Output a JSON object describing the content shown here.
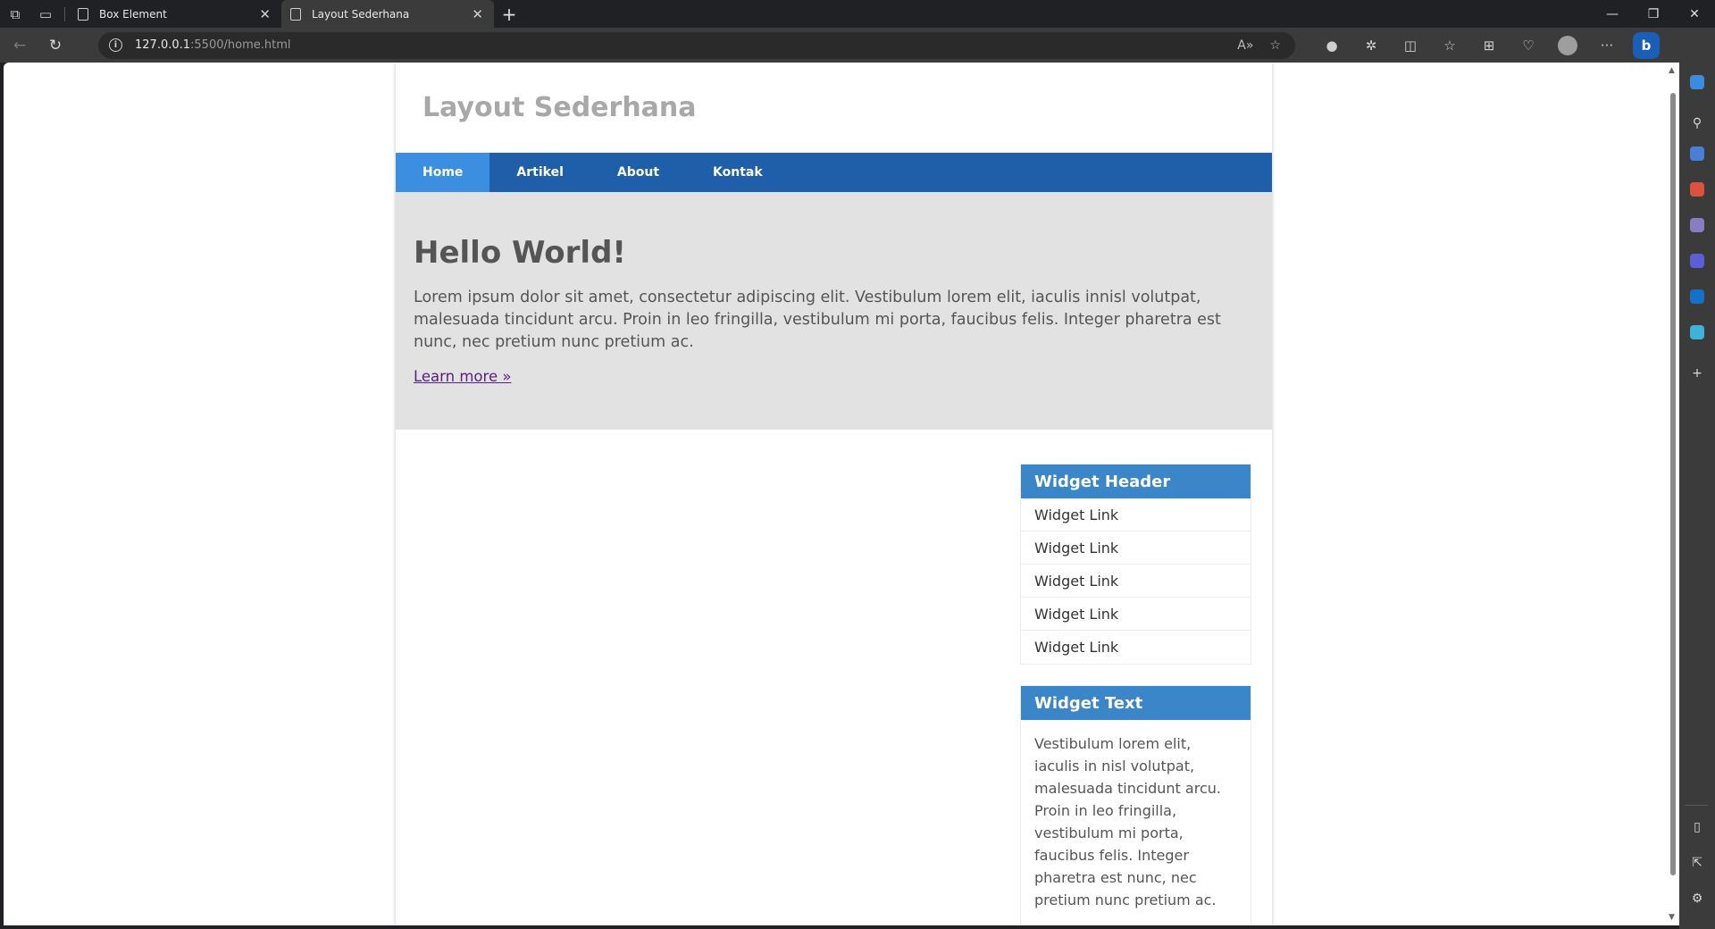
{
  "browser": {
    "tabs": [
      {
        "title": "Box Element",
        "close": "✕"
      },
      {
        "title": "Layout Sederhana",
        "close": "✕"
      }
    ],
    "new_tab": "+",
    "window_controls": {
      "minimize": "—",
      "restore": "❐",
      "close": "✕"
    },
    "address": {
      "host": "127.0.0.1",
      "path": ":5500/home.html"
    },
    "icons": [
      "workspaces-icon",
      "tab-actions-icon",
      "back-icon",
      "refresh-icon",
      "site-info-icon",
      "read-aloud-icon",
      "favorite-icon",
      "extension-icon",
      "split-screen-icon",
      "favorites-icon",
      "collections-icon",
      "performance-icon",
      "profile-icon",
      "more-icon",
      "copilot-icon"
    ]
  },
  "site": {
    "title": "Layout Sederhana",
    "nav": [
      "Home",
      "Artikel",
      "About",
      "Kontak"
    ],
    "hero": {
      "heading": "Hello World!",
      "text": "Lorem ipsum dolor sit amet, consectetur adipiscing elit. Vestibulum lorem elit, iaculis innisl volutpat, malesuada tincidunt arcu. Proin in leo fringilla, vestibulum mi porta, faucibus felis. Integer pharetra est nunc, nec pretium nunc pretium ac.",
      "link": "Learn more »"
    },
    "widget_links": {
      "header": "Widget Header",
      "links": [
        "Widget Link",
        "Widget Link",
        "Widget Link",
        "Widget Link",
        "Widget Link"
      ]
    },
    "widget_text": {
      "header": "Widget Text",
      "text": "Vestibulum lorem elit, iaculis in nisl volutpat, malesuada tincidunt arcu. Proin in leo fringilla, vestibulum mi porta, faucibus felis. Integer pharetra est nunc, nec pretium nunc pretium ac."
    }
  },
  "colors": {
    "nav_bar": "#1f5ea8",
    "nav_active": "#3b8ee0",
    "hero_bg": "#e2e2e2",
    "widget_header": "#3b86c8"
  }
}
